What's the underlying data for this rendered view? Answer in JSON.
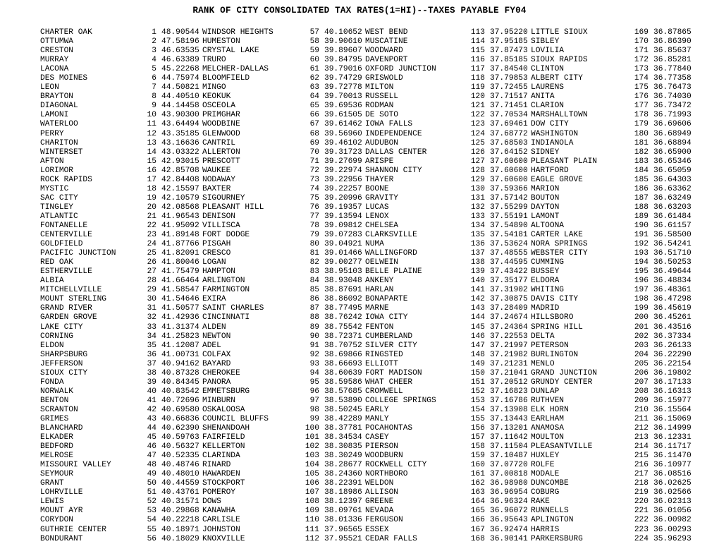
{
  "document": {
    "title": "RANK OF CITY CONSOLIDATED TAX RATES(1=HI)--TAXES PAYABLE FY04",
    "columns_count": 4,
    "rows_per_column": 56,
    "total_entries": 224
  },
  "chart_data": {
    "type": "table",
    "title": "RANK OF CITY CONSOLIDATED TAX RATES(1=HI)--TAXES PAYABLE FY04",
    "columns": [
      "city",
      "rank",
      "rate"
    ],
    "xlabel": "",
    "ylabel": "",
    "rows": [
      [
        "CHARTER OAK",
        1,
        "48.90544"
      ],
      [
        "OTTUMWA",
        2,
        "47.58196"
      ],
      [
        "CRESTON",
        3,
        "46.63535"
      ],
      [
        "MURRAY",
        4,
        "46.63389"
      ],
      [
        "LACONA",
        5,
        "45.22268"
      ],
      [
        "DES MOINES",
        6,
        "44.75974"
      ],
      [
        "LEON",
        7,
        "44.50821"
      ],
      [
        "BRAYTON",
        8,
        "44.40510"
      ],
      [
        "DIAGONAL",
        9,
        "44.14458"
      ],
      [
        "LAMONI",
        10,
        "43.90300"
      ],
      [
        "WATERLOO",
        11,
        "43.64494"
      ],
      [
        "PERRY",
        12,
        "43.35185"
      ],
      [
        "CHARITON",
        13,
        "43.16636"
      ],
      [
        "WINTERSET",
        14,
        "43.03322"
      ],
      [
        "AFTON",
        15,
        "42.93015"
      ],
      [
        "LORIMOR",
        16,
        "42.85708"
      ],
      [
        "ROCK RAPIDS",
        17,
        "42.84408"
      ],
      [
        "MYSTIC",
        18,
        "42.15597"
      ],
      [
        "SAC CITY",
        19,
        "42.10579"
      ],
      [
        "TINGLEY",
        20,
        "42.08568"
      ],
      [
        "ATLANTIC",
        21,
        "41.96543"
      ],
      [
        "FONTANELLE",
        22,
        "41.95092"
      ],
      [
        "CENTERVILLE",
        23,
        "41.89148"
      ],
      [
        "GOLDFIELD",
        24,
        "41.87766"
      ],
      [
        "PACIFIC JUNCTION",
        25,
        "41.82091"
      ],
      [
        "RED OAK",
        26,
        "41.80046"
      ],
      [
        "ESTHERVILLE",
        27,
        "41.75479"
      ],
      [
        "ALBIA",
        28,
        "41.66464"
      ],
      [
        "MITCHELLVILLE",
        29,
        "41.58547"
      ],
      [
        "MOUNT STERLING",
        30,
        "41.54646"
      ],
      [
        "GRAND RIVER",
        31,
        "41.50577"
      ],
      [
        "GARDEN GROVE",
        32,
        "41.42936"
      ],
      [
        "LAKE CITY",
        33,
        "41.31374"
      ],
      [
        "CORNING",
        34,
        "41.25823"
      ],
      [
        "ELDON",
        35,
        "41.12087"
      ],
      [
        "SHARPSBURG",
        36,
        "41.00731"
      ],
      [
        "JEFFERSON",
        37,
        "40.94162"
      ],
      [
        "SIOUX CITY",
        38,
        "40.87328"
      ],
      [
        "FONDA",
        39,
        "40.84345"
      ],
      [
        "NORWALK",
        40,
        "40.83542"
      ],
      [
        "BENTON",
        41,
        "40.72696"
      ],
      [
        "SCRANTON",
        42,
        "40.69580"
      ],
      [
        "GRIMES",
        43,
        "40.66836"
      ],
      [
        "BLANCHARD",
        44,
        "40.62390"
      ],
      [
        "ELKADER",
        45,
        "40.59763"
      ],
      [
        "BEDFORD",
        46,
        "40.56327"
      ],
      [
        "MELROSE",
        47,
        "40.52335"
      ],
      [
        "MISSOURI VALLEY",
        48,
        "40.48746"
      ],
      [
        "SEYMOUR",
        49,
        "40.48010"
      ],
      [
        "GRANT",
        50,
        "40.44559"
      ],
      [
        "LOHRVILLE",
        51,
        "40.43761"
      ],
      [
        "LEWIS",
        52,
        "40.31571"
      ],
      [
        "MOUNT AYR",
        53,
        "40.29868"
      ],
      [
        "CORYDON",
        54,
        "40.22218"
      ],
      [
        "GUTHRIE CENTER",
        55,
        "40.18971"
      ],
      [
        "BONDURANT",
        56,
        "40.18029"
      ],
      [
        "WINDSOR HEIGHTS",
        57,
        "40.10652"
      ],
      [
        "HUMESTON",
        58,
        "39.90610"
      ],
      [
        "CRYSTAL LAKE",
        59,
        "39.89607"
      ],
      [
        "TRURO",
        60,
        "39.84795"
      ],
      [
        "MELCHER-DALLAS",
        61,
        "39.79016"
      ],
      [
        "BLOOMFIELD",
        62,
        "39.74729"
      ],
      [
        "MINGO",
        63,
        "39.72778"
      ],
      [
        "KEOKUK",
        64,
        "39.70013"
      ],
      [
        "OSCEOLA",
        65,
        "39.69536"
      ],
      [
        "PRIMGHAR",
        66,
        "39.61505"
      ],
      [
        "WOODBINE",
        67,
        "39.61462"
      ],
      [
        "GLENWOOD",
        68,
        "39.56960"
      ],
      [
        "CANTRIL",
        69,
        "39.46102"
      ],
      [
        "ALLERTON",
        70,
        "39.31723"
      ],
      [
        "PRESCOTT",
        71,
        "39.27699"
      ],
      [
        "WAUKEE",
        72,
        "39.22974"
      ],
      [
        "NODAWAY",
        73,
        "39.22956"
      ],
      [
        "BAXTER",
        74,
        "39.22257"
      ],
      [
        "SIGOURNEY",
        75,
        "39.20996"
      ],
      [
        "PLEASANT HILL",
        76,
        "39.19357"
      ],
      [
        "DENISON",
        77,
        "39.13594"
      ],
      [
        "VILLISCA",
        78,
        "39.09812"
      ],
      [
        "FORT DODGE",
        79,
        "39.07283"
      ],
      [
        "PISGAH",
        80,
        "39.04921"
      ],
      [
        "CRESCO",
        81,
        "39.01466"
      ],
      [
        "LOGAN",
        82,
        "39.00277"
      ],
      [
        "HAMPTON",
        83,
        "38.95103"
      ],
      [
        "ARLINGTON",
        84,
        "38.93048"
      ],
      [
        "FARMINGTON",
        85,
        "38.87691"
      ],
      [
        "EXIRA",
        86,
        "38.86092"
      ],
      [
        "SAINT CHARLES",
        87,
        "38.77495"
      ],
      [
        "CINCINNATI",
        88,
        "38.76242"
      ],
      [
        "ALDEN",
        89,
        "38.75542"
      ],
      [
        "NEWTON",
        90,
        "38.72371"
      ],
      [
        "ADEL",
        91,
        "38.70752"
      ],
      [
        "COLFAX",
        92,
        "38.69866"
      ],
      [
        "BAYARD",
        93,
        "38.66693"
      ],
      [
        "CHEROKEE",
        94,
        "38.60639"
      ],
      [
        "PANORA",
        95,
        "38.59586"
      ],
      [
        "EMMETSBURG",
        96,
        "38.57685"
      ],
      [
        "MINBURN",
        97,
        "38.53890"
      ],
      [
        "OSKALOOSA",
        98,
        "38.50245"
      ],
      [
        "COUNCIL BLUFFS",
        99,
        "38.42289"
      ],
      [
        "SHENANDOAH",
        100,
        "38.37781"
      ],
      [
        "FAIRFIELD",
        101,
        "38.34534"
      ],
      [
        "KELLERTON",
        102,
        "38.30835"
      ],
      [
        "CLARINDA",
        103,
        "38.30249"
      ],
      [
        "RINARD",
        104,
        "38.28677"
      ],
      [
        "HAWARDEN",
        105,
        "38.24360"
      ],
      [
        "STOCKPORT",
        106,
        "38.22391"
      ],
      [
        "POMEROY",
        107,
        "38.18986"
      ],
      [
        "DOWS",
        108,
        "38.12397"
      ],
      [
        "KANAWHA",
        109,
        "38.09761"
      ],
      [
        "CARLISLE",
        110,
        "38.01336"
      ],
      [
        "JOHNSTON",
        111,
        "37.96565"
      ],
      [
        "KNOXVILLE",
        112,
        "37.95521"
      ],
      [
        "WEST BEND",
        113,
        "37.95220"
      ],
      [
        "MUSCATINE",
        114,
        "37.95185"
      ],
      [
        "WOODWARD",
        115,
        "37.87473"
      ],
      [
        "DAVENPORT",
        116,
        "37.85185"
      ],
      [
        "OXFORD JUNCTION",
        117,
        "37.84540"
      ],
      [
        "GRISWOLD",
        118,
        "37.79853"
      ],
      [
        "MILTON",
        119,
        "37.72455"
      ],
      [
        "RUSSELL",
        120,
        "37.71517"
      ],
      [
        "RODMAN",
        121,
        "37.71451"
      ],
      [
        "DE SOTO",
        122,
        "37.70534"
      ],
      [
        "IOWA FALLS",
        123,
        "37.69461"
      ],
      [
        "INDEPENDENCE",
        124,
        "37.68772"
      ],
      [
        "AUDUBON",
        125,
        "37.68503"
      ],
      [
        "DALLAS CENTER",
        126,
        "37.64152"
      ],
      [
        "ARISPE",
        127,
        "37.60600"
      ],
      [
        "SHANNON CITY",
        128,
        "37.60600"
      ],
      [
        "THAYER",
        129,
        "37.60600"
      ],
      [
        "BOONE",
        130,
        "37.59366"
      ],
      [
        "GRAVITY",
        131,
        "37.57142"
      ],
      [
        "LUCAS",
        132,
        "37.55299"
      ],
      [
        "LENOX",
        133,
        "37.55191"
      ],
      [
        "CHELSEA",
        134,
        "37.54890"
      ],
      [
        "CLARKSVILLE",
        135,
        "37.54181"
      ],
      [
        "NUMA",
        136,
        "37.53624"
      ],
      [
        "WALLINGFORD",
        137,
        "37.48555"
      ],
      [
        "OELWEIN",
        138,
        "37.44595"
      ],
      [
        "BELLE PLAINE",
        139,
        "37.43422"
      ],
      [
        "ANKENY",
        140,
        "37.35177"
      ],
      [
        "HARLAN",
        141,
        "37.31902"
      ],
      [
        "BONAPARTE",
        142,
        "37.30875"
      ],
      [
        "MARNE",
        143,
        "37.28409"
      ],
      [
        "IOWA CITY",
        144,
        "37.24674"
      ],
      [
        "FENTON",
        145,
        "37.24364"
      ],
      [
        "CUMBERLAND",
        146,
        "37.22553"
      ],
      [
        "SILVER CITY",
        147,
        "37.21997"
      ],
      [
        "RINGSTED",
        148,
        "37.21982"
      ],
      [
        "ELLIOTT",
        149,
        "37.21231"
      ],
      [
        "FORT MADISON",
        150,
        "37.21041"
      ],
      [
        "WHAT CHEER",
        151,
        "37.20512"
      ],
      [
        "CROMWELL",
        152,
        "37.16823"
      ],
      [
        "COLLEGE SPRINGS",
        153,
        "37.16786"
      ],
      [
        "EARLY",
        154,
        "37.13908"
      ],
      [
        "MANLY",
        155,
        "37.13443"
      ],
      [
        "POCAHONTAS",
        156,
        "37.13201"
      ],
      [
        "CASEY",
        157,
        "37.11642"
      ],
      [
        "PIERSON",
        158,
        "37.11504"
      ],
      [
        "WOODBURN",
        159,
        "37.10487"
      ],
      [
        "ROCKWELL CITY",
        160,
        "37.07720"
      ],
      [
        "NORTHBORO",
        161,
        "37.00818"
      ],
      [
        "WELDON",
        162,
        "36.98980"
      ],
      [
        "ALLISON",
        163,
        "36.96954"
      ],
      [
        "GREENE",
        164,
        "36.96324"
      ],
      [
        "NEVADA",
        165,
        "36.96072"
      ],
      [
        "FERGUSON",
        166,
        "36.95643"
      ],
      [
        "ESSEX",
        167,
        "36.92474"
      ],
      [
        "CEDAR FALLS",
        168,
        "36.90141"
      ],
      [
        "LITTLE SIOUX",
        169,
        "36.87865"
      ],
      [
        "SIBLEY",
        170,
        "36.86390"
      ],
      [
        "LOVILIA",
        171,
        "36.85637"
      ],
      [
        "SIOUX RAPIDS",
        172,
        "36.85281"
      ],
      [
        "CLINTON",
        173,
        "36.77840"
      ],
      [
        "ALBERT CITY",
        174,
        "36.77358"
      ],
      [
        "LAURENS",
        175,
        "36.76473"
      ],
      [
        "ANITA",
        176,
        "36.74030"
      ],
      [
        "CLARION",
        177,
        "36.73472"
      ],
      [
        "MARSHALLTOWN",
        178,
        "36.71993"
      ],
      [
        "DOW CITY",
        179,
        "36.69606"
      ],
      [
        "WASHINGTON",
        180,
        "36.68949"
      ],
      [
        "INDIANOLA",
        181,
        "36.68894"
      ],
      [
        "SIDNEY",
        182,
        "36.65900"
      ],
      [
        "PLEASANT PLAIN",
        183,
        "36.65346"
      ],
      [
        "HARTFORD",
        184,
        "36.65059"
      ],
      [
        "EAGLE GROVE",
        185,
        "36.64303"
      ],
      [
        "MARION",
        186,
        "36.63362"
      ],
      [
        "BOUTON",
        187,
        "36.63249"
      ],
      [
        "DAYTON",
        188,
        "36.63203"
      ],
      [
        "LAMONT",
        189,
        "36.61484"
      ],
      [
        "ALTOONA",
        190,
        "36.61157"
      ],
      [
        "CARTER LAKE",
        191,
        "36.58500"
      ],
      [
        "NORA SPRINGS",
        192,
        "36.54241"
      ],
      [
        "WEBSTER CITY",
        193,
        "36.51710"
      ],
      [
        "CUMMING",
        194,
        "36.50253"
      ],
      [
        "BUSSEY",
        195,
        "36.49644"
      ],
      [
        "ELDORA",
        196,
        "36.48834"
      ],
      [
        "WHITING",
        197,
        "36.48361"
      ],
      [
        "DAVIS CITY",
        198,
        "36.47298"
      ],
      [
        "MADRID",
        199,
        "36.45619"
      ],
      [
        "HILLSBORO",
        200,
        "36.45261"
      ],
      [
        "SPRING HILL",
        201,
        "36.43516"
      ],
      [
        "DELTA",
        202,
        "36.37334"
      ],
      [
        "PETERSON",
        203,
        "36.26133"
      ],
      [
        "BURLINGTON",
        204,
        "36.22290"
      ],
      [
        "MENLO",
        205,
        "36.22154"
      ],
      [
        "GRAND JUNCTION",
        206,
        "36.19802"
      ],
      [
        "GRUNDY CENTER",
        207,
        "36.17133"
      ],
      [
        "DUNLAP",
        208,
        "36.16313"
      ],
      [
        "RUTHVEN",
        209,
        "36.15977"
      ],
      [
        "ELK HORN",
        210,
        "36.15564"
      ],
      [
        "EARLHAM",
        211,
        "36.15069"
      ],
      [
        "ANAMOSA",
        212,
        "36.14999"
      ],
      [
        "MOULTON",
        213,
        "36.12331"
      ],
      [
        "PLEASANTVILLE",
        214,
        "36.11717"
      ],
      [
        "HUXLEY",
        215,
        "36.11470"
      ],
      [
        "ROLFE",
        216,
        "36.10977"
      ],
      [
        "MODALE",
        217,
        "36.08516"
      ],
      [
        "DUNCOMBE",
        218,
        "36.02625"
      ],
      [
        "COBURG",
        219,
        "36.02566"
      ],
      [
        "RAKE",
        220,
        "36.02313"
      ],
      [
        "RUNNELLS",
        221,
        "36.01056"
      ],
      [
        "APLINGTON",
        222,
        "36.00982"
      ],
      [
        "HARRIS",
        223,
        "36.00293"
      ],
      [
        "PARKERSBURG",
        224,
        "35.96293"
      ]
    ]
  }
}
